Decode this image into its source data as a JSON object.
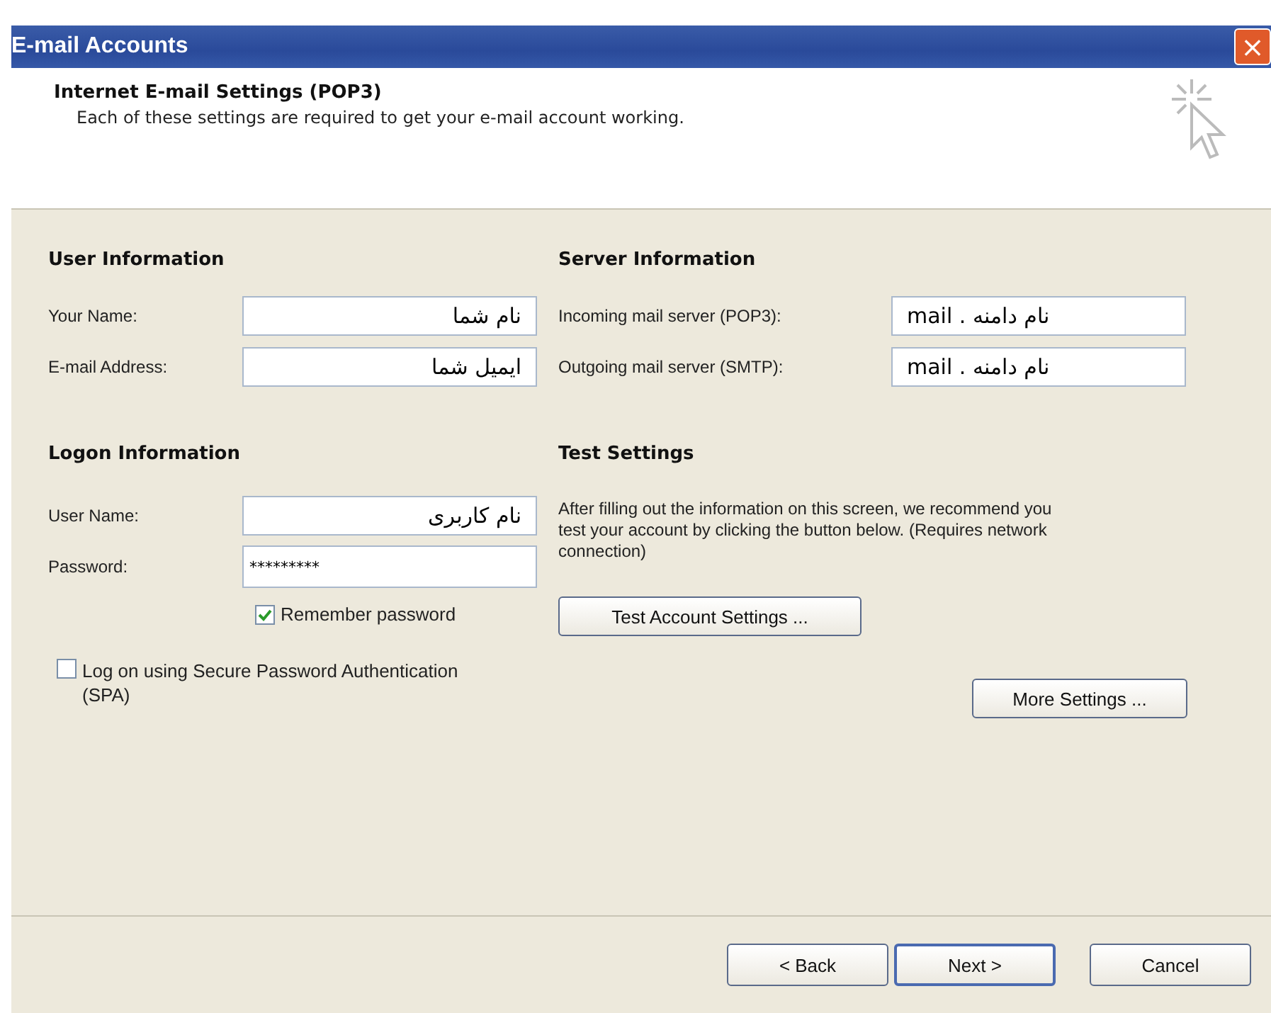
{
  "window": {
    "title": "E-mail Accounts",
    "close": "×"
  },
  "header": {
    "title": "Internet E-mail Settings (POP3)",
    "subtitle": "Each of these settings are required to get your e-mail account working."
  },
  "user_information": {
    "heading": "User Information",
    "fields": [
      {
        "label": "Your Name:",
        "value": "نام شما",
        "rtl": true
      },
      {
        "label": "E-mail Address:",
        "value": "ایمیل شما",
        "rtl": true
      }
    ]
  },
  "server_information": {
    "heading": "Server Information",
    "fields": [
      {
        "label": "Incoming mail server (POP3):",
        "value": "mail . نام دامنه",
        "rtl": false
      },
      {
        "label": "Outgoing mail server (SMTP):",
        "value": "mail . نام دامنه",
        "rtl": false
      }
    ]
  },
  "logon_information": {
    "heading": "Logon Information",
    "fields": [
      {
        "label": "User Name:",
        "value": "نام کاربری",
        "rtl": true
      },
      {
        "label": "Password:",
        "value": "*********",
        "rtl": false
      }
    ],
    "remember_password": {
      "label": "Remember password",
      "checked": true
    },
    "spa": {
      "label": "Log on using Secure Password Authentication (SPA)",
      "checked": false
    }
  },
  "test_settings": {
    "heading": "Test Settings",
    "text": "After filling out the information on this screen, we recommend you test your account by clicking the button below. (Requires network connection)",
    "button": "Test Account Settings ..."
  },
  "more_settings": "More Settings ...",
  "buttons": [
    {
      "label": "< Back",
      "default": false
    },
    {
      "label": "Next >",
      "default": true
    },
    {
      "label": "Cancel",
      "default": false
    }
  ]
}
